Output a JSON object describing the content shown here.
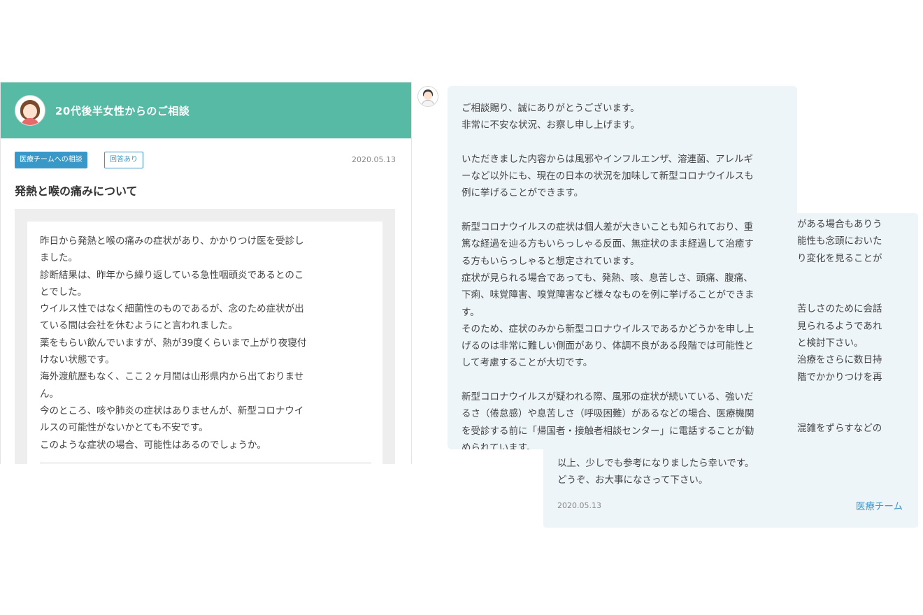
{
  "consultation": {
    "title": "20代後半女性からのご相談",
    "tag_team": "医療チームへの相談",
    "tag_answered": "回答あり",
    "date": "2020.05.13",
    "subject": "発熱と喉の痛みについて",
    "question": "昨日から発熱と喉の痛みの症状があり、かかりつけ医を受診し\nました。\n診断結果は、昨年から繰り返している急性咽頭炎であるとのこ\nとでした。\nウイルス性ではなく細菌性のものであるが、念のため症状が出\nている間は会社を休むようにと言われました。\n薬をもらい飲んでいますが、熱が39度くらいまで上がり夜寝付\nけない状態です。\n海外渡航歴もなく、ここ２ヶ月間は山形県内から出ておりませ\nん。\n今のところ、咳や肺炎の症状はありませんが、新型コロナウイ\nルスの可能性がないかとても不安です。\nこのような症状の場合、可能性はあるのでしょうか。"
  },
  "answer": {
    "body": "ご相談賜り、誠にありがとうございます。\n非常に不安な状況、お察し申し上げます。\n\nいただきました内容からは風邪やインフルエンザ、溶連菌、アレルギ\nーなど以外にも、現在の日本の状況を加味して新型コロナウイルスも\n例に挙げることができます。\n\n新型コロナウイルスの症状は個人差が大きいことも知られており、重\n篤な経過を辿る方もいらっしゃる反面、無症状のまま経過して治癒す\nる方もいらっしゃると想定されています。\n症状が見られる場合であっても、発熱、咳、息苦しさ、頭痛、腹痛、\n下痢、味覚障害、嗅覚障害など様々なものを例に挙げることができま\nす。\nそのため、症状のみから新型コロナウイルスであるかどうかを申し上\nげるのは非常に難しい側面があり、体調不良がある段階では可能性と\nして考慮することが大切です。\n\n新型コロナウイルスが疑われる際、風邪の症状が続いている、強いだ\nるさ（倦怠感）や息苦しさ（呼吸困難）があるなどの場合、医療機関\nを受診する前に「帰国者・接触者相談センター」に電話することが勧\nめられています。\nこうした症状に当てはまる状況があれば、お住まいの市町村の相談窓\n口に相談されることを検討下さい。",
    "continued": "がある場合もありう\n能性も念頭においた\nり変化を見ることが\n\n\n苦しさのために会話\n見られるようであれ\nと検討下さい。\n治療をさらに数日持\n階でかかりつけを再\n\n\n混雑をずらすなどの\nとで受診に際しての",
    "closing": "以上、少しでも参考になりましたら幸いです。\nどうぞ、お大事になさって下さい。",
    "date": "2020.05.13",
    "team": "医療チーム"
  }
}
